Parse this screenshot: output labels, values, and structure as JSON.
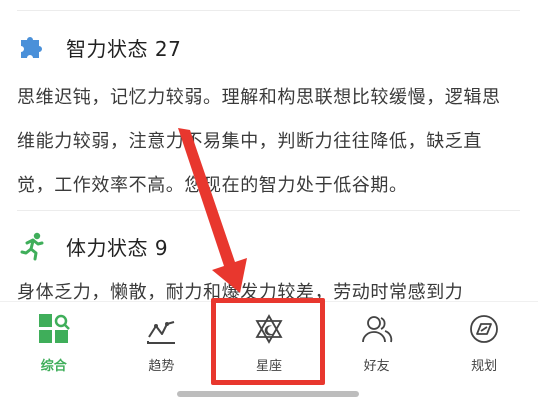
{
  "sections": {
    "intelligence": {
      "title": "智力状态 27",
      "icon": "puzzle-icon",
      "text": "思维迟钝，记忆力较弱。理解和构思联想比较缓慢，逻辑思维能力较弱，注意力不易集中，判断力往往降低，缺乏直觉，工作效率不高。您现在的智力处于低谷期。"
    },
    "physical": {
      "title": "体力状态 9",
      "icon": "running-person-icon",
      "text": "身体乏力，懒散，耐力和爆发力较差，劳动时常感到力"
    }
  },
  "tabbar": {
    "tabs": [
      {
        "label": "综合",
        "icon": "dashboard-icon",
        "active": true
      },
      {
        "label": "趋势",
        "icon": "trend-chart-icon",
        "active": false
      },
      {
        "label": "星座",
        "icon": "star-of-david-moon-icon",
        "active": false
      },
      {
        "label": "好友",
        "icon": "friends-icon",
        "active": false
      },
      {
        "label": "规划",
        "icon": "planning-icon",
        "active": false
      }
    ]
  },
  "colors": {
    "accent": "#3fae5a",
    "icon_blue": "#4a90d9",
    "highlight": "#e8372e"
  }
}
